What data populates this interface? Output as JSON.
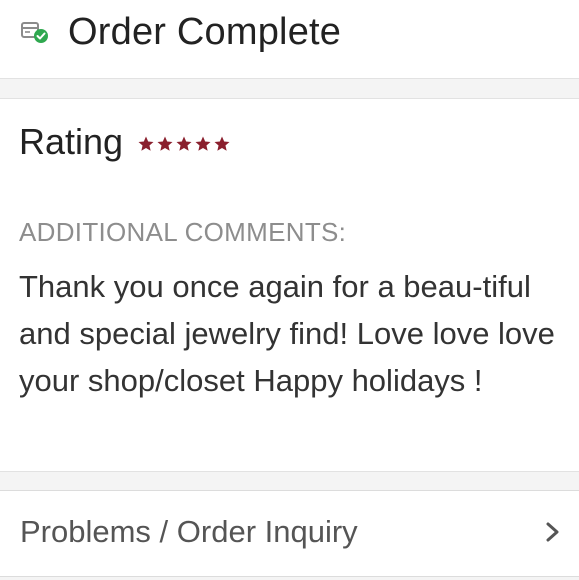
{
  "header": {
    "title": "Order Complete",
    "icon": "order-box-check-icon"
  },
  "rating": {
    "label": "Rating",
    "stars": 5,
    "max_stars": 5,
    "star_color": "#8a1f2d"
  },
  "comments": {
    "heading": "ADDITIONAL COMMENTS:",
    "text": "Thank you once again for a beau-tiful and special jewelry find! Love love love your shop/closet Happy holidays !"
  },
  "inquiry": {
    "label": "Problems / Order Inquiry",
    "icon": "chevron-right-icon"
  },
  "colors": {
    "check_green": "#2fa84f",
    "star": "#8a1f2d"
  }
}
